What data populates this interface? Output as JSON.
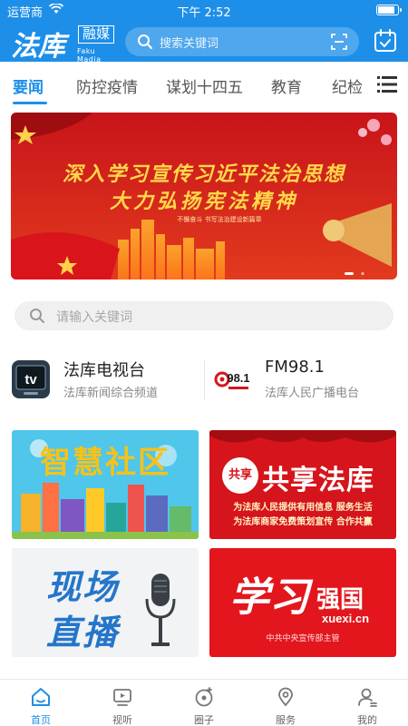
{
  "status_bar": {
    "carrier": "运营商",
    "time": "下午 2:52",
    "battery_level": 0.9
  },
  "header": {
    "logo_main": "法库",
    "logo_brand": "融媒",
    "logo_en": "Faku Madia",
    "search_placeholder": "搜索关键词",
    "accent_color": "#1e8fe8"
  },
  "tabs": [
    {
      "label": "要闻",
      "active": true
    },
    {
      "label": "防控疫情",
      "active": false
    },
    {
      "label": "谋划十四五",
      "active": false
    },
    {
      "label": "教育",
      "active": false
    },
    {
      "label": "纪检",
      "active": false
    }
  ],
  "banner": {
    "line1": "深入学习宣传习近平法治思想",
    "line2": "大力弘扬宪法精神",
    "slogan": "不懈奋斗 书写法治建设新篇章"
  },
  "search2": {
    "placeholder": "请输入关键词"
  },
  "channels": [
    {
      "title": "法库电视台",
      "subtitle": "法库新闻综合频道",
      "icon": "tv-icon",
      "icon_text": "tv"
    },
    {
      "title": "FM98.1",
      "subtitle": "法库人民广播电台",
      "icon": "fm-radio-icon",
      "icon_text": "98.1"
    }
  ],
  "tiles": {
    "smart_community": {
      "text": "智慧社区"
    },
    "shared_faku": {
      "seal": "共享",
      "text": "共享法库",
      "line1": "为法库人民提供有用信息 服务生活",
      "line2": "为法库商家免费策划宣传 合作共赢"
    },
    "live": {
      "line1": "现场",
      "line2": "直播"
    },
    "xuexi": {
      "script": "学习",
      "title": "强国",
      "domain": "xuexi.cn",
      "caption": "中共中央宣传部主管"
    }
  },
  "bottom_nav": [
    {
      "label": "首页",
      "icon": "home-icon",
      "active": true
    },
    {
      "label": "视听",
      "icon": "tv-icon",
      "active": false
    },
    {
      "label": "圈子",
      "icon": "circle-icon",
      "active": false
    },
    {
      "label": "服务",
      "icon": "location-pin-icon",
      "active": false
    },
    {
      "label": "我的",
      "icon": "user-icon",
      "active": false
    }
  ]
}
